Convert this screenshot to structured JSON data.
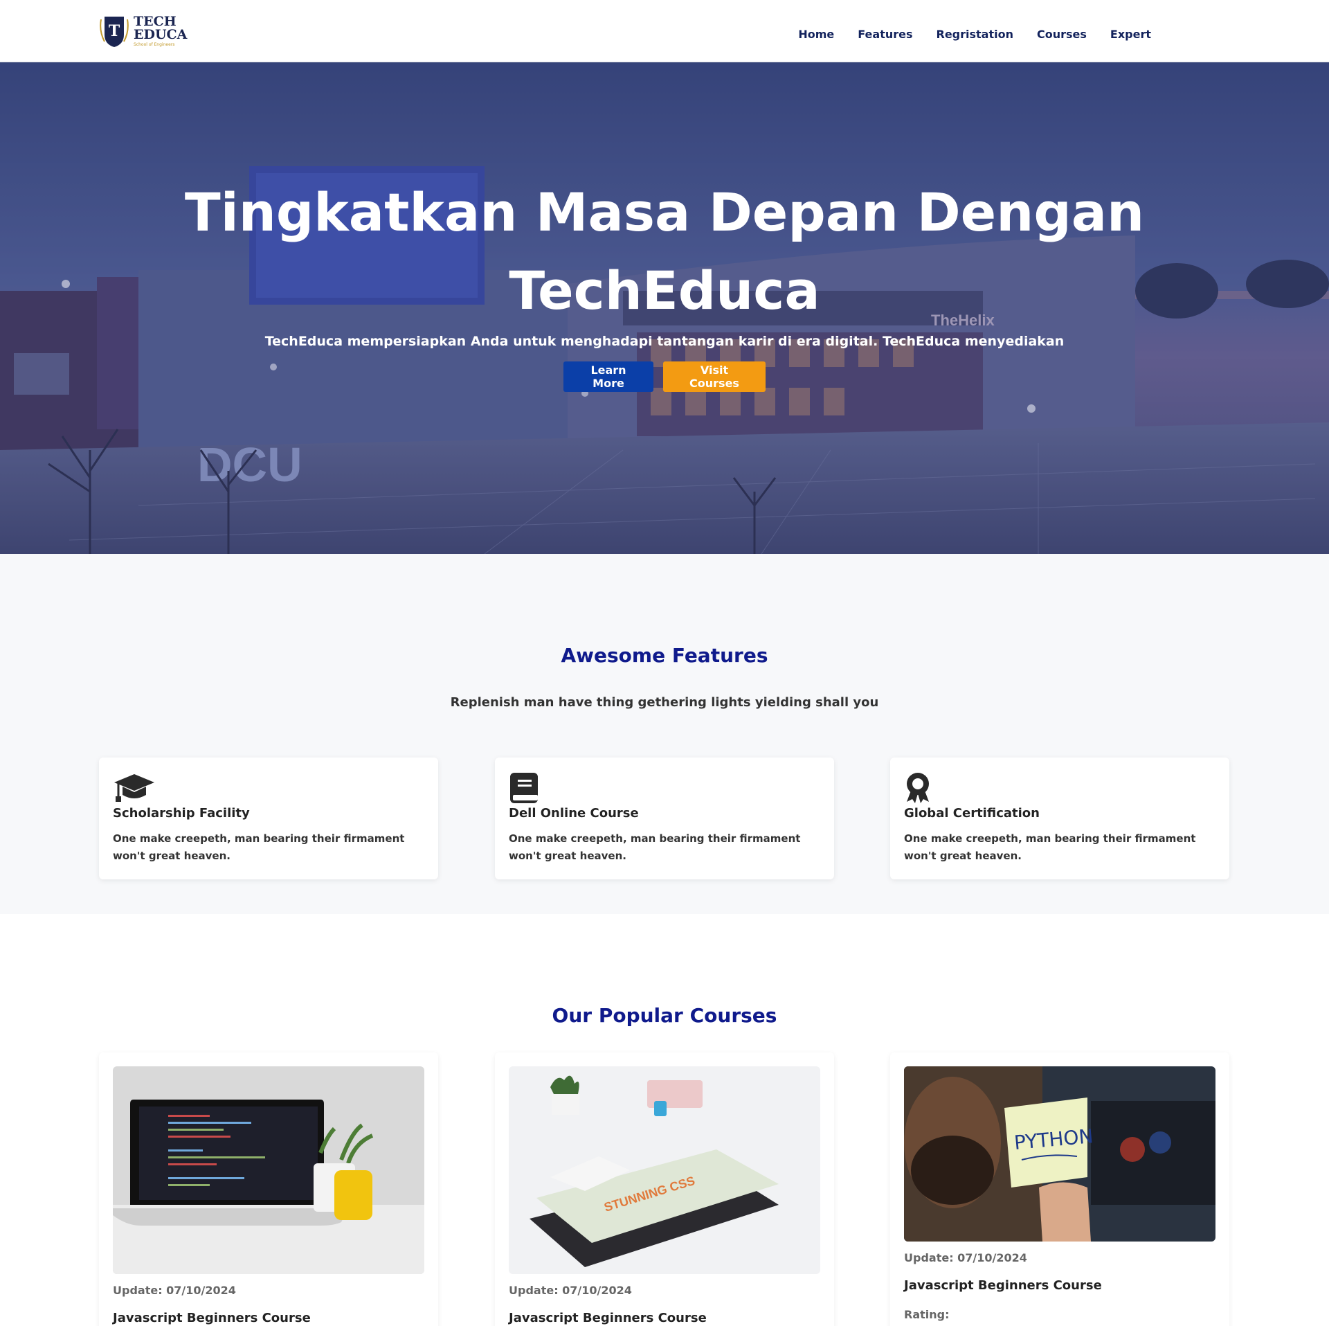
{
  "brand": {
    "line1": "TECH",
    "line2": "EDUCA",
    "tagline": "School of Engineers",
    "shield_letter": "T"
  },
  "nav": {
    "links": [
      "Home",
      "Features",
      "Regristation",
      "Courses",
      "Expert"
    ]
  },
  "hero": {
    "title_line1": "Tingkatkan Masa Depan Dengan",
    "title_line2": "TechEduca",
    "subtitle": "TechEduca mempersiapkan Anda untuk menghadapi tantangan karir di era digital. TechEduca menyediakan",
    "learn_more": "Learn More",
    "visit_courses": "Visit Courses",
    "sign_dcu": "DCU",
    "sign_helix": "TheHelix"
  },
  "features": {
    "title": "Awesome Features",
    "subtitle": "Replenish man have thing gethering lights yielding shall you",
    "items": [
      {
        "icon": "graduation-cap-icon",
        "title": "Scholarship Facility",
        "desc": "One make creepeth, man bearing their firmament won't great heaven."
      },
      {
        "icon": "book-icon",
        "title": "Dell Online Course",
        "desc": "One make creepeth, man bearing their firmament won't great heaven."
      },
      {
        "icon": "award-icon",
        "title": "Global Certification",
        "desc": "One make creepeth, man bearing their firmament won't great heaven."
      }
    ]
  },
  "courses": {
    "title": "Our Popular Courses",
    "items": [
      {
        "update": "Update: 07/10/2024",
        "title": "Javascript Beginners Course",
        "image": "laptop-code-photo"
      },
      {
        "update": "Update: 07/10/2024",
        "title": "Javascript Beginners Course",
        "image": "css-books-photo",
        "book_text": "STUNNING CSS"
      },
      {
        "update": "Update: 07/10/2024",
        "title": "Javascript Beginners Course",
        "image": "python-note-photo",
        "note_text": "PYTHON",
        "rating_label": "Rating:"
      }
    ]
  },
  "colors": {
    "navy": "#12225c",
    "heading_blue": "#0f1a8c",
    "primary_button": "#0b3fa8",
    "warning_button": "#f39b12",
    "section_bg": "#f7f8fa"
  }
}
